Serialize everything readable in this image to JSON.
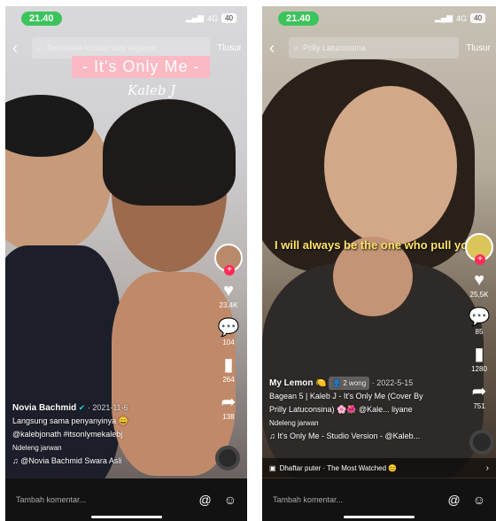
{
  "left": {
    "status": {
      "time": "21.40",
      "signal": "4G",
      "battery": "40"
    },
    "search": {
      "text": "Temokake konten sing kegayut",
      "button": "Tlusur"
    },
    "overlay": {
      "title": "- It's Only Me -",
      "artist": "Kaleb J"
    },
    "actions": {
      "likes": "23,4K",
      "comments": "104",
      "saves": "264",
      "shares": "138"
    },
    "caption": {
      "user": "Novia Bachmid",
      "date": "· 2021-11-6",
      "text": "Langsung sama penyanyinya 😄",
      "tags": "@kalebjonath #itsonlymekalebj",
      "translate": "Ndeleng jarwan",
      "sound": "♫ @Novia Bachmid Swara Asli"
    },
    "comment_placeholder": "Tambah komentar..."
  },
  "right": {
    "status": {
      "time": "21.40",
      "signal": "4G",
      "battery": "40"
    },
    "search": {
      "text": "Prilly Latuconsina",
      "button": "Tlusur"
    },
    "lyric": "I will always be the one who pull you",
    "actions": {
      "likes": "25,5K",
      "comments": "85",
      "saves": "1280",
      "shares": "751"
    },
    "caption": {
      "user": "My Lemon 🍋",
      "friends": "👤 2 wong",
      "date": "· 2022-5-15",
      "line1": "Bagean 5 | Kaleb J - It's Only Me (Cover By",
      "line2": "Prilly Latuconsina) 🌸🌺 @Kale... liyane",
      "translate": "Ndeleng jarwan",
      "sound": "♫ It's Only Me - Studio Version - @Kaleb..."
    },
    "playlist": "Dhaftar puter · The Most Watched 😊",
    "comment_placeholder": "Tambah komentar..."
  }
}
